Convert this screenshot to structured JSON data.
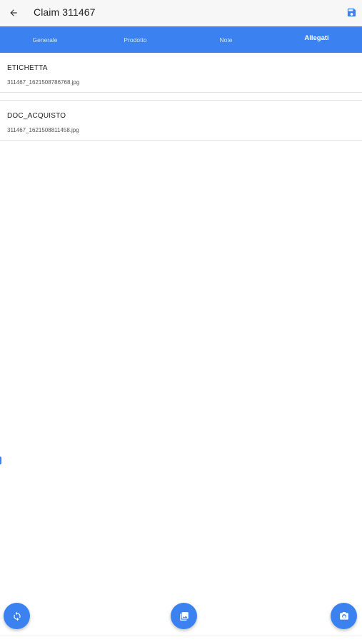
{
  "header": {
    "title": "Claim 311467",
    "icons": {
      "back": "arrow-back-icon",
      "save": "save-floppy-icon"
    }
  },
  "tabs": [
    {
      "label": "Generale",
      "active": false
    },
    {
      "label": "Prodotto",
      "active": false
    },
    {
      "label": "Note",
      "active": false
    },
    {
      "label": "Allegati",
      "active": true
    }
  ],
  "attachments": [
    {
      "type": "ETICHETTA",
      "filename": "311467_1621508786768.jpg"
    },
    {
      "type": "DOC_ACQUISTO",
      "filename": "311467_1621508811458.jpg"
    }
  ],
  "fabs": {
    "refresh": "refresh-icon",
    "gallery": "image-gallery-icon",
    "camera": "camera-icon"
  },
  "colors": {
    "accent": "#3b82f0",
    "header_bg": "#f7f7f7",
    "text": "#222222",
    "muted": "#555555"
  }
}
